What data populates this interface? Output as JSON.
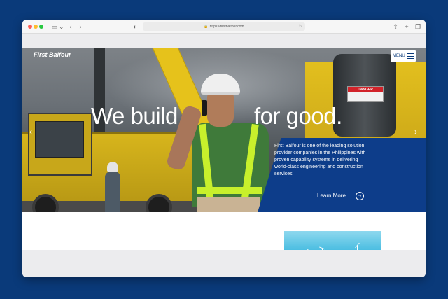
{
  "browser": {
    "url": "https://firstbalfour.com"
  },
  "site": {
    "logo": "First Balfour",
    "menu_label": "MENU"
  },
  "hero": {
    "headline_left": "We build",
    "headline_right": "for good.",
    "description": "First Balfour is one of the leading solution provider companies in the Philippines with proven capability systems in delivering world-class engineering and construction services.",
    "cta": "Learn More"
  },
  "icons": {
    "prev": "chevron-left-icon",
    "next": "chevron-right-icon",
    "cta": "arrow-circle-right-icon"
  },
  "colors": {
    "brand": "#0d3d8a",
    "background": "#0a3a7a"
  }
}
